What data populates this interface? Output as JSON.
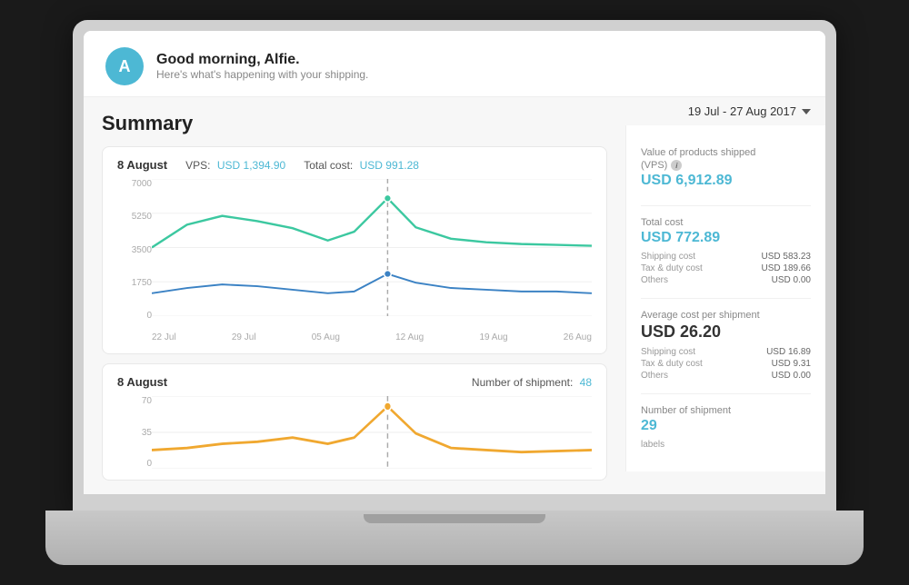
{
  "greeting": {
    "avatar_letter": "A",
    "title": "Good morning, Alfie.",
    "subtitle": "Here's what's happening with your shipping."
  },
  "date_range": {
    "label": "19 Jul - 27 Aug 2017",
    "chevron": "▾"
  },
  "summary_title": "Summary",
  "chart1": {
    "date": "8 August",
    "vps_label": "VPS:",
    "vps_value": "USD 1,394.90",
    "total_cost_label": "Total cost:",
    "total_cost_value": "USD 991.28",
    "y_labels": [
      "7000",
      "5250",
      "3500",
      "1750",
      "0"
    ],
    "x_labels": [
      "22 Jul",
      "29 Jul",
      "05 Aug",
      "12 Aug",
      "19 Aug",
      "26 Aug"
    ]
  },
  "chart2": {
    "date": "8 August",
    "shipment_label": "Number of shipment:",
    "shipment_value": "48",
    "y_labels": [
      "70",
      "35",
      "0"
    ],
    "x_labels": []
  },
  "stats": {
    "vps": {
      "label": "Value of products shipped",
      "label2": "(VPS)",
      "value": "USD 6,912.89"
    },
    "total_cost": {
      "label": "Total cost",
      "value": "USD 772.89",
      "rows": [
        {
          "label": "Shipping cost",
          "value": "USD 583.23"
        },
        {
          "label": "Tax & duty cost",
          "value": "USD 189.66"
        },
        {
          "label": "Others",
          "value": "USD 0.00"
        }
      ]
    },
    "avg_cost": {
      "label": "Average cost per shipment",
      "value": "USD 26.20",
      "rows": [
        {
          "label": "Shipping cost",
          "value": "USD 16.89"
        },
        {
          "label": "Tax & duty cost",
          "value": "USD 9.31"
        },
        {
          "label": "Others",
          "value": "USD 0.00"
        }
      ]
    },
    "num_shipment": {
      "label": "Number of shipment",
      "value": "29",
      "sub": "labels"
    }
  }
}
